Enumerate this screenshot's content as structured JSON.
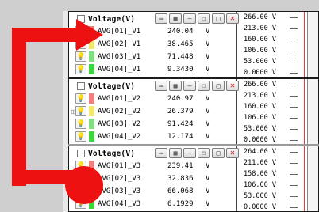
{
  "ticks": [
    "266.00 V",
    "213.00 V",
    "160.00 V",
    "106.00 V",
    "53.000 V",
    "0.0000 V"
  ],
  "ticks_bottom": [
    "264.00 V",
    "211.00 V",
    "158.00 V",
    "106.00 V",
    "53.000 V",
    "0.0000 V"
  ],
  "panels": [
    {
      "title": "Voltage(V)",
      "rows": [
        {
          "name": "AVG[01]_V1",
          "value": "240.04",
          "unit": "V",
          "color": "#f08080"
        },
        {
          "name": "AVG[02]_V1",
          "value": "38.465",
          "unit": "V",
          "color": "#f2e86a"
        },
        {
          "name": "AVG[03]_V1",
          "value": "71.448",
          "unit": "V",
          "color": "#7ee07e"
        },
        {
          "name": "AVG[04]_V1",
          "value": "9.3430",
          "unit": "V",
          "color": "#3cd63c"
        }
      ]
    },
    {
      "title": "Voltage(V)",
      "rows": [
        {
          "name": "AVG[01]_V2",
          "value": "240.97",
          "unit": "V",
          "color": "#f08080"
        },
        {
          "name": "AVG[02]_V2",
          "value": "26.379",
          "unit": "V",
          "color": "#f2e86a"
        },
        {
          "name": "AVG[03]_V2",
          "value": "91.424",
          "unit": "V",
          "color": "#7ee07e"
        },
        {
          "name": "AVG[04]_V2",
          "value": "12.174",
          "unit": "V",
          "color": "#3cd63c"
        }
      ]
    },
    {
      "title": "Voltage(V)",
      "rows": [
        {
          "name": "AVG[01]_V3",
          "value": "239.41",
          "unit": "V",
          "color": "#f08080"
        },
        {
          "name": "AVG[02]_V3",
          "value": "32.836",
          "unit": "V",
          "color": "#f2e86a"
        },
        {
          "name": "AVG[03]_V3",
          "value": "66.068",
          "unit": "V",
          "color": "#7ee07e"
        },
        {
          "name": "AVG[04]_V3",
          "value": "6.1929",
          "unit": "V",
          "color": "#3cd63c"
        }
      ]
    }
  ],
  "overlay": {
    "arrow_color": "#ee1111"
  }
}
